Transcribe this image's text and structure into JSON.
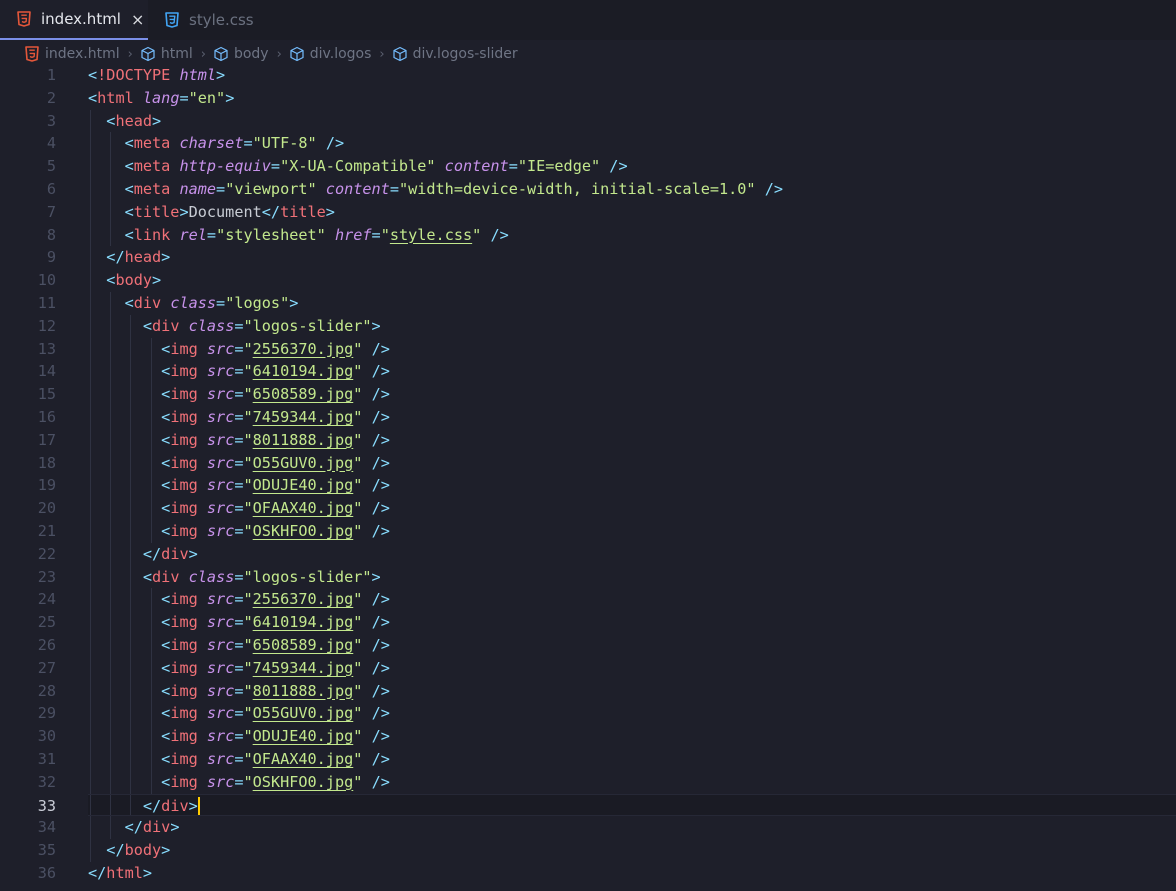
{
  "tabs": [
    {
      "label": "index.html",
      "icon": "html5-icon",
      "active": true,
      "close": "×"
    },
    {
      "label": "style.css",
      "icon": "css3-icon",
      "active": false
    }
  ],
  "breadcrumb": [
    {
      "label": "index.html",
      "icon": "html5-icon"
    },
    {
      "label": "html",
      "icon": "symbol-cube-icon"
    },
    {
      "label": "body",
      "icon": "symbol-cube-icon"
    },
    {
      "label": "div.logos",
      "icon": "symbol-cube-icon"
    },
    {
      "label": "div.logos-slider",
      "icon": "symbol-cube-icon"
    }
  ],
  "colors": {
    "background": "#1e1f2a",
    "angle": "#89ddff",
    "tag": "#f07178",
    "attribute": "#c792ea",
    "string": "#c3e88d",
    "cursor": "#ffcc00"
  },
  "current_line": 33,
  "lines": [
    {
      "n": "1",
      "indent": 0,
      "tokens": [
        [
          "ang",
          "<"
        ],
        [
          "tag",
          "!DOCTYPE"
        ],
        [
          "plain",
          " "
        ],
        [
          "attr",
          "html"
        ],
        [
          "ang",
          ">"
        ]
      ]
    },
    {
      "n": "2",
      "indent": 0,
      "tokens": [
        [
          "ang",
          "<"
        ],
        [
          "tag",
          "html"
        ],
        [
          "plain",
          " "
        ],
        [
          "attr",
          "lang"
        ],
        [
          "ang",
          "="
        ],
        [
          "str",
          "\"en\""
        ],
        [
          "ang",
          ">"
        ]
      ]
    },
    {
      "n": "3",
      "indent": 1,
      "tokens": [
        [
          "ang",
          "<"
        ],
        [
          "tag",
          "head"
        ],
        [
          "ang",
          ">"
        ]
      ]
    },
    {
      "n": "4",
      "indent": 2,
      "tokens": [
        [
          "ang",
          "<"
        ],
        [
          "tag",
          "meta"
        ],
        [
          "plain",
          " "
        ],
        [
          "attr",
          "charset"
        ],
        [
          "ang",
          "="
        ],
        [
          "str",
          "\"UTF-8\""
        ],
        [
          "plain",
          " "
        ],
        [
          "ang",
          "/>"
        ]
      ]
    },
    {
      "n": "5",
      "indent": 2,
      "tokens": [
        [
          "ang",
          "<"
        ],
        [
          "tag",
          "meta"
        ],
        [
          "plain",
          " "
        ],
        [
          "attr",
          "http-equiv"
        ],
        [
          "ang",
          "="
        ],
        [
          "str",
          "\"X-UA-Compatible\""
        ],
        [
          "plain",
          " "
        ],
        [
          "attr",
          "content"
        ],
        [
          "ang",
          "="
        ],
        [
          "str",
          "\"IE=edge\""
        ],
        [
          "plain",
          " "
        ],
        [
          "ang",
          "/>"
        ]
      ]
    },
    {
      "n": "6",
      "indent": 2,
      "tokens": [
        [
          "ang",
          "<"
        ],
        [
          "tag",
          "meta"
        ],
        [
          "plain",
          " "
        ],
        [
          "attr",
          "name"
        ],
        [
          "ang",
          "="
        ],
        [
          "str",
          "\"viewport\""
        ],
        [
          "plain",
          " "
        ],
        [
          "attr",
          "content"
        ],
        [
          "ang",
          "="
        ],
        [
          "str",
          "\"width=device-width, initial-scale=1.0\""
        ],
        [
          "plain",
          " "
        ],
        [
          "ang",
          "/>"
        ]
      ]
    },
    {
      "n": "7",
      "indent": 2,
      "tokens": [
        [
          "ang",
          "<"
        ],
        [
          "tag",
          "title"
        ],
        [
          "ang",
          ">"
        ],
        [
          "plain",
          "Document"
        ],
        [
          "ang",
          "</"
        ],
        [
          "tag",
          "title"
        ],
        [
          "ang",
          ">"
        ]
      ]
    },
    {
      "n": "8",
      "indent": 2,
      "tokens": [
        [
          "ang",
          "<"
        ],
        [
          "tag",
          "link"
        ],
        [
          "plain",
          " "
        ],
        [
          "attr",
          "rel"
        ],
        [
          "ang",
          "="
        ],
        [
          "str",
          "\"stylesheet\""
        ],
        [
          "plain",
          " "
        ],
        [
          "attr",
          "href"
        ],
        [
          "ang",
          "="
        ],
        [
          "str",
          "\""
        ],
        [
          "link",
          "style.css"
        ],
        [
          "str",
          "\""
        ],
        [
          "plain",
          " "
        ],
        [
          "ang",
          "/>"
        ]
      ]
    },
    {
      "n": "9",
      "indent": 1,
      "tokens": [
        [
          "ang",
          "</"
        ],
        [
          "tag",
          "head"
        ],
        [
          "ang",
          ">"
        ]
      ]
    },
    {
      "n": "10",
      "indent": 1,
      "tokens": [
        [
          "ang",
          "<"
        ],
        [
          "tag",
          "body"
        ],
        [
          "ang",
          ">"
        ]
      ]
    },
    {
      "n": "11",
      "indent": 2,
      "tokens": [
        [
          "ang",
          "<"
        ],
        [
          "tag",
          "div"
        ],
        [
          "plain",
          " "
        ],
        [
          "attr",
          "class"
        ],
        [
          "ang",
          "="
        ],
        [
          "str",
          "\"logos\""
        ],
        [
          "ang",
          ">"
        ]
      ]
    },
    {
      "n": "12",
      "indent": 3,
      "tokens": [
        [
          "ang",
          "<"
        ],
        [
          "tag",
          "div"
        ],
        [
          "plain",
          " "
        ],
        [
          "attr",
          "class"
        ],
        [
          "ang",
          "="
        ],
        [
          "str",
          "\"logos-slider\""
        ],
        [
          "ang",
          ">"
        ]
      ]
    },
    {
      "n": "13",
      "indent": 4,
      "tokens": [
        [
          "ang",
          "<"
        ],
        [
          "tag",
          "img"
        ],
        [
          "plain",
          " "
        ],
        [
          "attr",
          "src"
        ],
        [
          "ang",
          "="
        ],
        [
          "str",
          "\""
        ],
        [
          "link",
          "2556370.jpg"
        ],
        [
          "str",
          "\""
        ],
        [
          "plain",
          " "
        ],
        [
          "ang",
          "/>"
        ]
      ]
    },
    {
      "n": "14",
      "indent": 4,
      "tokens": [
        [
          "ang",
          "<"
        ],
        [
          "tag",
          "img"
        ],
        [
          "plain",
          " "
        ],
        [
          "attr",
          "src"
        ],
        [
          "ang",
          "="
        ],
        [
          "str",
          "\""
        ],
        [
          "link",
          "6410194.jpg"
        ],
        [
          "str",
          "\""
        ],
        [
          "plain",
          " "
        ],
        [
          "ang",
          "/>"
        ]
      ]
    },
    {
      "n": "15",
      "indent": 4,
      "tokens": [
        [
          "ang",
          "<"
        ],
        [
          "tag",
          "img"
        ],
        [
          "plain",
          " "
        ],
        [
          "attr",
          "src"
        ],
        [
          "ang",
          "="
        ],
        [
          "str",
          "\""
        ],
        [
          "link",
          "6508589.jpg"
        ],
        [
          "str",
          "\""
        ],
        [
          "plain",
          " "
        ],
        [
          "ang",
          "/>"
        ]
      ]
    },
    {
      "n": "16",
      "indent": 4,
      "tokens": [
        [
          "ang",
          "<"
        ],
        [
          "tag",
          "img"
        ],
        [
          "plain",
          " "
        ],
        [
          "attr",
          "src"
        ],
        [
          "ang",
          "="
        ],
        [
          "str",
          "\""
        ],
        [
          "link",
          "7459344.jpg"
        ],
        [
          "str",
          "\""
        ],
        [
          "plain",
          " "
        ],
        [
          "ang",
          "/>"
        ]
      ]
    },
    {
      "n": "17",
      "indent": 4,
      "tokens": [
        [
          "ang",
          "<"
        ],
        [
          "tag",
          "img"
        ],
        [
          "plain",
          " "
        ],
        [
          "attr",
          "src"
        ],
        [
          "ang",
          "="
        ],
        [
          "str",
          "\""
        ],
        [
          "link",
          "8011888.jpg"
        ],
        [
          "str",
          "\""
        ],
        [
          "plain",
          " "
        ],
        [
          "ang",
          "/>"
        ]
      ]
    },
    {
      "n": "18",
      "indent": 4,
      "tokens": [
        [
          "ang",
          "<"
        ],
        [
          "tag",
          "img"
        ],
        [
          "plain",
          " "
        ],
        [
          "attr",
          "src"
        ],
        [
          "ang",
          "="
        ],
        [
          "str",
          "\""
        ],
        [
          "link",
          "O55GUV0.jpg"
        ],
        [
          "str",
          "\""
        ],
        [
          "plain",
          " "
        ],
        [
          "ang",
          "/>"
        ]
      ]
    },
    {
      "n": "19",
      "indent": 4,
      "tokens": [
        [
          "ang",
          "<"
        ],
        [
          "tag",
          "img"
        ],
        [
          "plain",
          " "
        ],
        [
          "attr",
          "src"
        ],
        [
          "ang",
          "="
        ],
        [
          "str",
          "\""
        ],
        [
          "link",
          "ODUJE40.jpg"
        ],
        [
          "str",
          "\""
        ],
        [
          "plain",
          " "
        ],
        [
          "ang",
          "/>"
        ]
      ]
    },
    {
      "n": "20",
      "indent": 4,
      "tokens": [
        [
          "ang",
          "<"
        ],
        [
          "tag",
          "img"
        ],
        [
          "plain",
          " "
        ],
        [
          "attr",
          "src"
        ],
        [
          "ang",
          "="
        ],
        [
          "str",
          "\""
        ],
        [
          "link",
          "OFAAX40.jpg"
        ],
        [
          "str",
          "\""
        ],
        [
          "plain",
          " "
        ],
        [
          "ang",
          "/>"
        ]
      ]
    },
    {
      "n": "21",
      "indent": 4,
      "tokens": [
        [
          "ang",
          "<"
        ],
        [
          "tag",
          "img"
        ],
        [
          "plain",
          " "
        ],
        [
          "attr",
          "src"
        ],
        [
          "ang",
          "="
        ],
        [
          "str",
          "\""
        ],
        [
          "link",
          "OSKHFO0.jpg"
        ],
        [
          "str",
          "\""
        ],
        [
          "plain",
          " "
        ],
        [
          "ang",
          "/>"
        ]
      ]
    },
    {
      "n": "22",
      "indent": 3,
      "tokens": [
        [
          "ang",
          "</"
        ],
        [
          "tag",
          "div"
        ],
        [
          "ang",
          ">"
        ]
      ]
    },
    {
      "n": "23",
      "indent": 3,
      "tokens": [
        [
          "ang",
          "<"
        ],
        [
          "tag",
          "div"
        ],
        [
          "plain",
          " "
        ],
        [
          "attr",
          "class"
        ],
        [
          "ang",
          "="
        ],
        [
          "str",
          "\"logos-slider\""
        ],
        [
          "ang",
          ">"
        ]
      ]
    },
    {
      "n": "24",
      "indent": 4,
      "tokens": [
        [
          "ang",
          "<"
        ],
        [
          "tag",
          "img"
        ],
        [
          "plain",
          " "
        ],
        [
          "attr",
          "src"
        ],
        [
          "ang",
          "="
        ],
        [
          "str",
          "\""
        ],
        [
          "link",
          "2556370.jpg"
        ],
        [
          "str",
          "\""
        ],
        [
          "plain",
          " "
        ],
        [
          "ang",
          "/>"
        ]
      ]
    },
    {
      "n": "25",
      "indent": 4,
      "tokens": [
        [
          "ang",
          "<"
        ],
        [
          "tag",
          "img"
        ],
        [
          "plain",
          " "
        ],
        [
          "attr",
          "src"
        ],
        [
          "ang",
          "="
        ],
        [
          "str",
          "\""
        ],
        [
          "link",
          "6410194.jpg"
        ],
        [
          "str",
          "\""
        ],
        [
          "plain",
          " "
        ],
        [
          "ang",
          "/>"
        ]
      ]
    },
    {
      "n": "26",
      "indent": 4,
      "tokens": [
        [
          "ang",
          "<"
        ],
        [
          "tag",
          "img"
        ],
        [
          "plain",
          " "
        ],
        [
          "attr",
          "src"
        ],
        [
          "ang",
          "="
        ],
        [
          "str",
          "\""
        ],
        [
          "link",
          "6508589.jpg"
        ],
        [
          "str",
          "\""
        ],
        [
          "plain",
          " "
        ],
        [
          "ang",
          "/>"
        ]
      ]
    },
    {
      "n": "27",
      "indent": 4,
      "tokens": [
        [
          "ang",
          "<"
        ],
        [
          "tag",
          "img"
        ],
        [
          "plain",
          " "
        ],
        [
          "attr",
          "src"
        ],
        [
          "ang",
          "="
        ],
        [
          "str",
          "\""
        ],
        [
          "link",
          "7459344.jpg"
        ],
        [
          "str",
          "\""
        ],
        [
          "plain",
          " "
        ],
        [
          "ang",
          "/>"
        ]
      ]
    },
    {
      "n": "28",
      "indent": 4,
      "tokens": [
        [
          "ang",
          "<"
        ],
        [
          "tag",
          "img"
        ],
        [
          "plain",
          " "
        ],
        [
          "attr",
          "src"
        ],
        [
          "ang",
          "="
        ],
        [
          "str",
          "\""
        ],
        [
          "link",
          "8011888.jpg"
        ],
        [
          "str",
          "\""
        ],
        [
          "plain",
          " "
        ],
        [
          "ang",
          "/>"
        ]
      ]
    },
    {
      "n": "29",
      "indent": 4,
      "tokens": [
        [
          "ang",
          "<"
        ],
        [
          "tag",
          "img"
        ],
        [
          "plain",
          " "
        ],
        [
          "attr",
          "src"
        ],
        [
          "ang",
          "="
        ],
        [
          "str",
          "\""
        ],
        [
          "link",
          "O55GUV0.jpg"
        ],
        [
          "str",
          "\""
        ],
        [
          "plain",
          " "
        ],
        [
          "ang",
          "/>"
        ]
      ]
    },
    {
      "n": "30",
      "indent": 4,
      "tokens": [
        [
          "ang",
          "<"
        ],
        [
          "tag",
          "img"
        ],
        [
          "plain",
          " "
        ],
        [
          "attr",
          "src"
        ],
        [
          "ang",
          "="
        ],
        [
          "str",
          "\""
        ],
        [
          "link",
          "ODUJE40.jpg"
        ],
        [
          "str",
          "\""
        ],
        [
          "plain",
          " "
        ],
        [
          "ang",
          "/>"
        ]
      ]
    },
    {
      "n": "31",
      "indent": 4,
      "tokens": [
        [
          "ang",
          "<"
        ],
        [
          "tag",
          "img"
        ],
        [
          "plain",
          " "
        ],
        [
          "attr",
          "src"
        ],
        [
          "ang",
          "="
        ],
        [
          "str",
          "\""
        ],
        [
          "link",
          "OFAAX40.jpg"
        ],
        [
          "str",
          "\""
        ],
        [
          "plain",
          " "
        ],
        [
          "ang",
          "/>"
        ]
      ]
    },
    {
      "n": "32",
      "indent": 4,
      "tokens": [
        [
          "ang",
          "<"
        ],
        [
          "tag",
          "img"
        ],
        [
          "plain",
          " "
        ],
        [
          "attr",
          "src"
        ],
        [
          "ang",
          "="
        ],
        [
          "str",
          "\""
        ],
        [
          "link",
          "OSKHFO0.jpg"
        ],
        [
          "str",
          "\""
        ],
        [
          "plain",
          " "
        ],
        [
          "ang",
          "/>"
        ]
      ]
    },
    {
      "n": "33",
      "indent": 3,
      "tokens": [
        [
          "ang",
          "</"
        ],
        [
          "tag",
          "div"
        ],
        [
          "ang",
          ">"
        ]
      ]
    },
    {
      "n": "34",
      "indent": 2,
      "tokens": [
        [
          "ang",
          "</"
        ],
        [
          "tag",
          "div"
        ],
        [
          "ang",
          ">"
        ]
      ]
    },
    {
      "n": "35",
      "indent": 1,
      "tokens": [
        [
          "ang",
          "</"
        ],
        [
          "tag",
          "body"
        ],
        [
          "ang",
          ">"
        ]
      ]
    },
    {
      "n": "36",
      "indent": 0,
      "tokens": [
        [
          "ang",
          "</"
        ],
        [
          "tag",
          "html"
        ],
        [
          "ang",
          ">"
        ]
      ]
    }
  ]
}
